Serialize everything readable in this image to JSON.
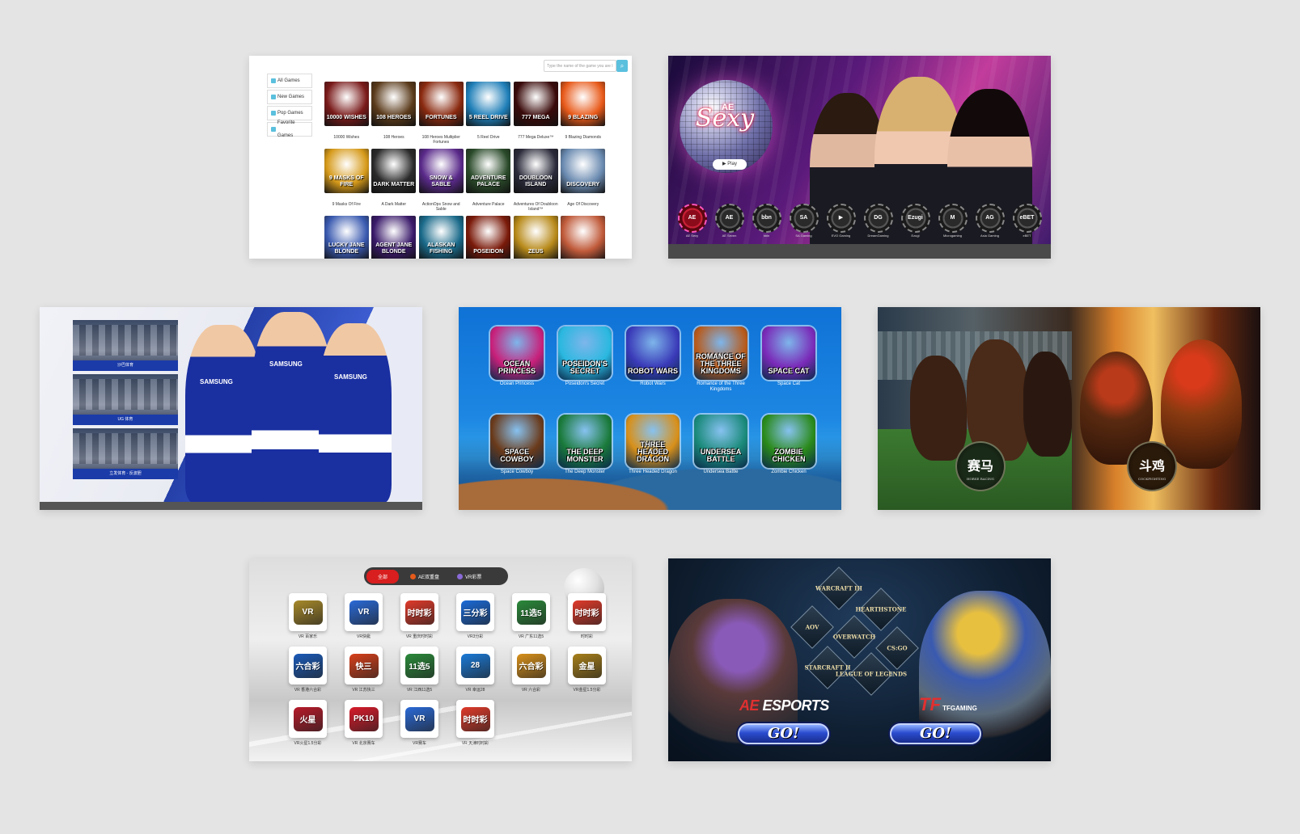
{
  "slot_lobby": {
    "search_placeholder": "Type the name of the game you are l",
    "search_button_icon": "search-icon",
    "sidebar": [
      {
        "label": "All Games",
        "icon": "all-games-icon"
      },
      {
        "label": "New Games",
        "icon": "star-icon"
      },
      {
        "label": "Pop Games",
        "icon": "trophy-icon"
      },
      {
        "label": "Favorite Games",
        "icon": "heart-icon"
      }
    ],
    "games": [
      {
        "name": "10000 Wishes",
        "art": "10000 WISHES",
        "color": "#7a1a1a"
      },
      {
        "name": "108 Heroes",
        "art": "108 HEROES",
        "color": "#5a3a1a"
      },
      {
        "name": "108 Heroes Multiplier Fortunes",
        "art": "FORTUNES",
        "color": "#8a2a10"
      },
      {
        "name": "5 Reel Drive",
        "art": "5 REEL DRIVE",
        "color": "#1f7fb8"
      },
      {
        "name": "777 Mega Deluxe™",
        "art": "777 MEGA",
        "color": "#3a0a0a"
      },
      {
        "name": "9 Blazing Diamonds",
        "art": "9 BLAZING",
        "color": "#e85a1a"
      },
      {
        "name": "9 Masks Of Fire",
        "art": "9 MASKS OF FIRE",
        "color": "#d69a1a"
      },
      {
        "name": "A Dark Matter",
        "art": "DARK MATTER",
        "color": "#2a2a2a"
      },
      {
        "name": "ActionOps Snow and Sable",
        "art": "SNOW & SABLE",
        "color": "#5a2a8a"
      },
      {
        "name": "Adventure Palace",
        "art": "ADVENTURE PALACE",
        "color": "#2a4a2a"
      },
      {
        "name": "Adventures Of Doubloon Island™",
        "art": "DOUBLOON ISLAND",
        "color": "#2a2a3a"
      },
      {
        "name": "Age Of Discovery",
        "art": "DISCOVERY",
        "color": "#6a8ab0"
      },
      {
        "name": "",
        "art": "LUCKY JANE BLONDE",
        "color": "#3a5ab0"
      },
      {
        "name": "",
        "art": "AGENT JANE BLONDE",
        "color": "#3a1a6a"
      },
      {
        "name": "",
        "art": "ALASKAN FISHING",
        "color": "#1a6a8a"
      },
      {
        "name": "",
        "art": "POSEIDON",
        "color": "#7a1a0a"
      },
      {
        "name": "",
        "art": "ZEUS",
        "color": "#b88a1a"
      },
      {
        "name": "",
        "art": "",
        "color": "#c05a3a"
      }
    ]
  },
  "ae_sexy": {
    "logo_brand": "AE",
    "logo": "Sexy",
    "play_label": "▶ Play",
    "chips": [
      {
        "art": "AE",
        "label": "AE Sexy",
        "active": true
      },
      {
        "art": "AE",
        "label": "AE Seven"
      },
      {
        "art": "bbn",
        "label": "bbin"
      },
      {
        "art": "SA",
        "label": "SA Gaming"
      },
      {
        "art": "▶",
        "label": "EVO Gaming"
      },
      {
        "art": "DG",
        "label": "DreamGaming"
      },
      {
        "art": "Ezugi",
        "label": "Ezugi"
      },
      {
        "art": "M",
        "label": "Microgaming"
      },
      {
        "art": "AG",
        "label": "Asia Gaming"
      },
      {
        "art": "eBET",
        "label": "eBET"
      }
    ]
  },
  "sports": {
    "cards": [
      "沙巴体育",
      "UG 体育",
      "立发体育 - 反波胆"
    ],
    "jersey_text": "SAMSUNG"
  },
  "fishing": {
    "games": [
      {
        "name": "Ocean Princess",
        "art": "OCEAN PRINCESS",
        "color": "#c8207a"
      },
      {
        "name": "Poseidon's Secret",
        "art": "POSEIDON'S SECRET",
        "color": "#2ab8e0"
      },
      {
        "name": "Robot Wars",
        "art": "ROBOT WARS",
        "color": "#3a3ab8"
      },
      {
        "name": "Romance of the Three Kingdoms",
        "art": "ROMANCE OF THE THREE KINGDOMS",
        "color": "#b85a1a"
      },
      {
        "name": "Space Cat",
        "art": "SPACE CAT",
        "color": "#7a2ab8"
      },
      {
        "name": "Space Cowboy",
        "art": "SPACE COWBOY",
        "color": "#6a3a1a"
      },
      {
        "name": "The Deep Monster",
        "art": "THE DEEP MONSTER",
        "color": "#1a7a3a"
      },
      {
        "name": "Three Headed Dragon",
        "art": "THREE HEADED DRAGON",
        "color": "#d8901a"
      },
      {
        "name": "Undersea Battle",
        "art": "UNDERSEA BATTLE",
        "color": "#1a8a7a"
      },
      {
        "name": "Zombie Chicken",
        "art": "ZOMBIE CHICKEN",
        "color": "#2a8a1a"
      }
    ]
  },
  "racing": {
    "horse_title": "赛马",
    "horse_subtitle": "HORSE RACING",
    "cock_title": "斗鸡",
    "cock_subtitle": "COCKFIGHTING"
  },
  "vr_lottery": {
    "tabs": [
      {
        "label": "全部",
        "active": true
      },
      {
        "label": "AE双重盘",
        "icon_color": "#e55a1a"
      },
      {
        "label": "VR彩票",
        "icon_color": "#8a6ad8"
      }
    ],
    "games": [
      {
        "name": "VR 百家乐",
        "art": "VR",
        "color": "#a88a2a"
      },
      {
        "name": "VR快艇",
        "art": "VR",
        "color": "#2a6ad8"
      },
      {
        "name": "VR 重庆时时彩",
        "art": "时时彩",
        "color": "#e03a2a"
      },
      {
        "name": "VR3分彩",
        "art": "三分彩",
        "color": "#1a6ad8"
      },
      {
        "name": "VR 广东11选5",
        "art": "11选5",
        "color": "#2a8a3a"
      },
      {
        "name": "时时彩",
        "art": "时时彩",
        "color": "#e03a2a"
      },
      {
        "name": "VR 香港六合彩",
        "art": "六合彩",
        "color": "#1a5ab8"
      },
      {
        "name": "VR 江苏快三",
        "art": "快三",
        "color": "#d8401a"
      },
      {
        "name": "VR 江西11选5",
        "art": "11选5",
        "color": "#2a8a3a"
      },
      {
        "name": "VR 幸运28",
        "art": "28",
        "color": "#1a7ad8"
      },
      {
        "name": "VR 六合彩",
        "art": "六合彩",
        "color": "#d8901a"
      },
      {
        "name": "VR金星1.5分彩",
        "art": "金星",
        "color": "#a8801a"
      },
      {
        "name": "VR火星1.5分彩",
        "art": "火星",
        "color": "#b81a2a"
      },
      {
        "name": "VR 北京赛车",
        "art": "PK10",
        "color": "#d81a2a"
      },
      {
        "name": "VR赛车",
        "art": "VR",
        "color": "#2a6ad8"
      },
      {
        "name": "VR 天津时时彩",
        "art": "时时彩",
        "color": "#e03a2a"
      }
    ]
  },
  "esports": {
    "diamonds": [
      "WARCRAFT III",
      "HEARTHSTONE",
      "AOV",
      "OVERWATCH",
      "CS:GO",
      "STARCRAFT II",
      "LEAGUE OF LEGENDS"
    ],
    "ae_prefix": "AE",
    "ae_rest": " ESPORTS",
    "tg_prefix": "TF",
    "tg_rest": "TFGAMING",
    "go_label": "GO!"
  }
}
